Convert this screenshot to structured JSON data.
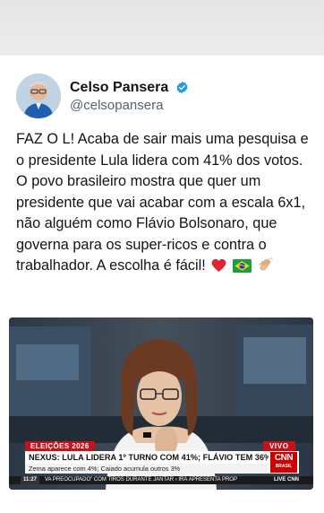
{
  "author": {
    "name": "Celso Pansera",
    "handle": "@celsopansera"
  },
  "tweet": {
    "text": "FAZ O L! Acaba de sair mais uma pesquisa e o presidente Lula lidera com 41% dos votos. O povo brasileiro mostra que quer um presidente que vai acabar com a escala 6x1, não alguém como Flávio Bolsonaro, que governa para os super-ricos e contra o trabalhador. A escolha é fácil!",
    "emojis": [
      "heart-emoji",
      "brazil-flag-emoji",
      "clapping-hands-emoji"
    ]
  },
  "video": {
    "section_tag": "ELEIÇÕES 2026",
    "live_tag": "VIVO",
    "headline": "NEXUS: LULA LIDERA 1º TURNO COM 41%; FLÁVIO TEM 36%",
    "subline": "Zema aparece com 4%; Caiado acumula outros 3%",
    "network": "CNN",
    "network_sub": "BRASIL",
    "ticker_time": "11:27",
    "ticker_text": "VA PREOCUPADO\" COM TIROS DURANTE JANTAR  ›  IRÁ APRESENTA PROP",
    "ticker_brand": "LIVE CNN"
  },
  "colors": {
    "text": "#0f1419",
    "handle": "#536471",
    "verified": "#1d9bf0",
    "cnn_red": "#cc0000",
    "tag_red": "#c4121a"
  }
}
